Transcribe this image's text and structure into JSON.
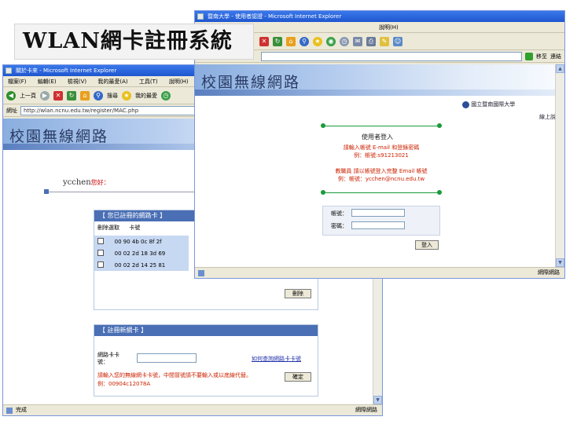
{
  "slide_title": "WLAN網卡註冊系統",
  "back_window": {
    "title": "關於卡來 - Microsoft Internet Explorer",
    "menu": [
      "檔案(F)",
      "編輯(E)",
      "檢視(V)",
      "我的最愛(A)",
      "工具(T)",
      "說明(H)"
    ],
    "toolbar": {
      "back": "上一頁",
      "search": "搜尋",
      "favorites": "我的最愛"
    },
    "address_label": "網址",
    "address": "http://wlan.ncnu.edu.tw/register/MAC.php",
    "banner_title": "校園無線網路",
    "user": {
      "name": "ycchen",
      "suffix": "您好："
    },
    "registered_panel": {
      "title": "【 您已註冊的網路卡 】",
      "headers": [
        "刪除選取",
        "卡號"
      ],
      "rows": [
        {
          "mac": "00 90 4b 0c 8f 2f"
        },
        {
          "mac": "00 02 2d 18 3d 69"
        },
        {
          "mac": "00 02 2d 14 25 81"
        }
      ],
      "delete_button": "刪除"
    },
    "new_card_panel": {
      "title": "【 註冊新網卡 】",
      "mac_label": "網路卡卡號：",
      "mac_value": "",
      "lookup_link": "如何查詢網路卡卡號",
      "note": "請輸入您的無線網卡卡號，中間冒號請不要輸入或以底線代替。",
      "example": "例：00904c12078A",
      "submit_button": "確定"
    },
    "status": "完成",
    "zone": "網際網路"
  },
  "front_window": {
    "title": "暨南大學 - 使用者認證 - Microsoft Internet Explorer",
    "menu_fragment": "說明(H)",
    "address_go": "移至",
    "links": "連結",
    "banner_title": "校園無線網路",
    "university": "國立暨南國際大學",
    "online_help": "線上說明",
    "login": {
      "title": "使用者登入",
      "instruction_1": "請輸入帳號 E-mail 和登錄密碼",
      "example_1": "例：帳號:s91213021",
      "instruction_2": "教職員 請以帳號登入完整 Email 帳號",
      "example_2": "例：帳號：ycchen@ncnu.edu.tw",
      "account_label": "帳號：",
      "password_label": "密碼：",
      "submit_button": "登入"
    },
    "status": "",
    "zone": "網際網路"
  },
  "colors": {
    "titlebar": "#2a63dc",
    "panel_header": "#4a6fb5",
    "instruction_red": "#cc2200",
    "divider_green": "#1a9a3a"
  }
}
